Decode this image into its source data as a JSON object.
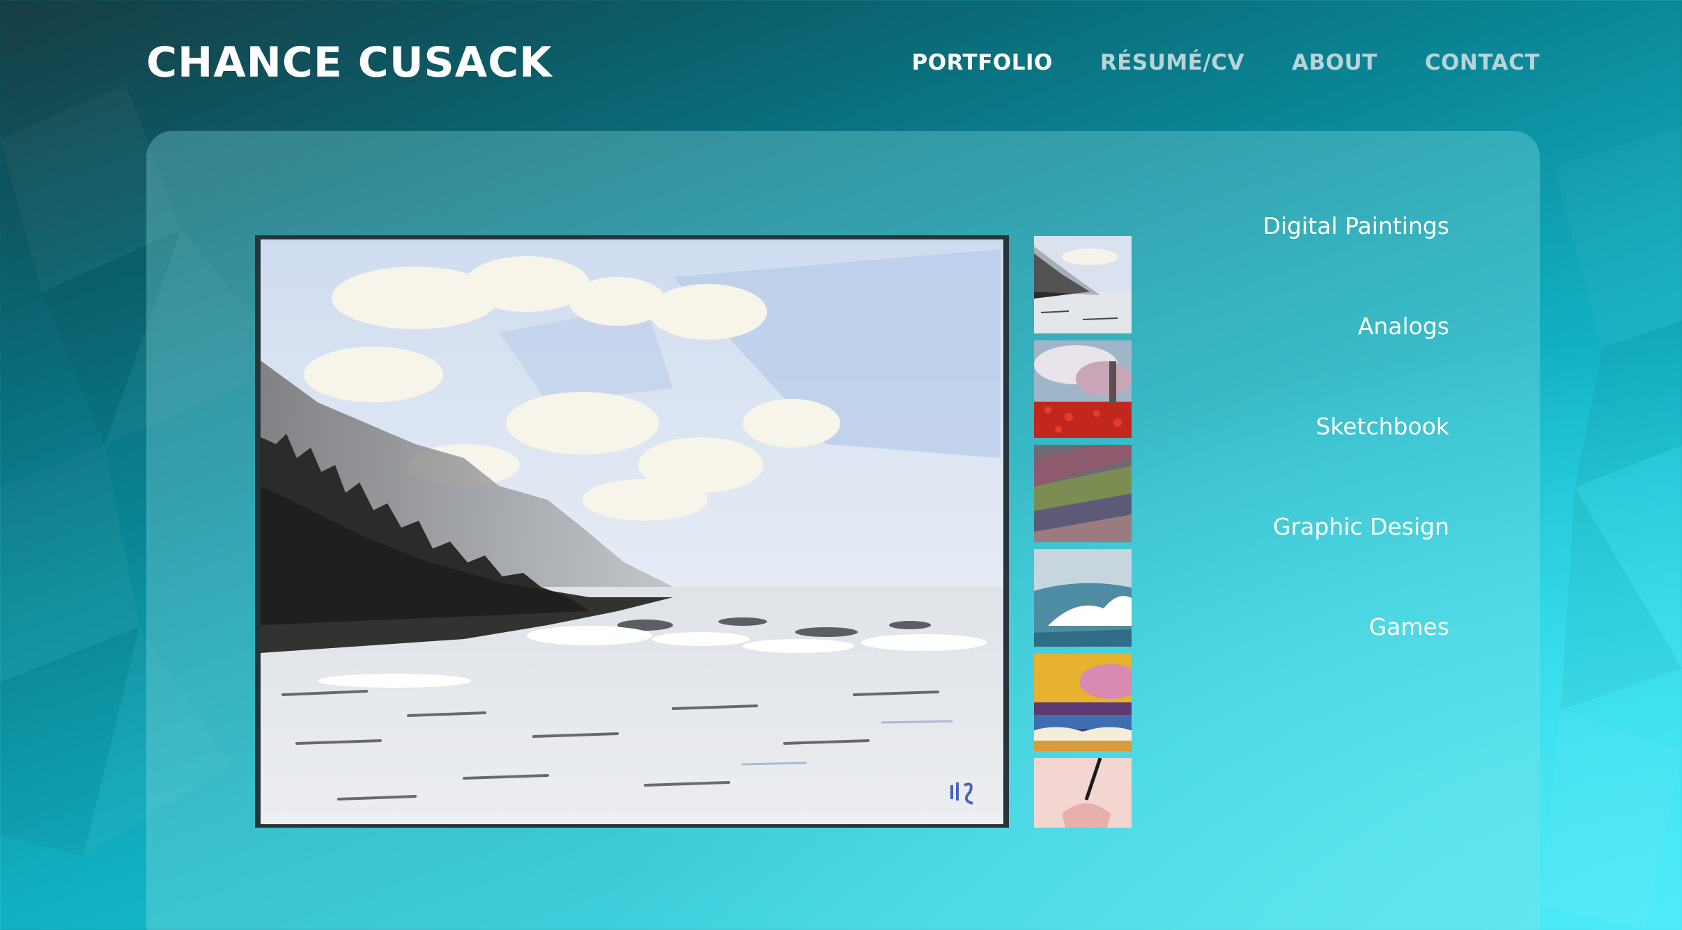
{
  "site": {
    "brand": "CHANCE CUSACK"
  },
  "nav": {
    "items": [
      {
        "label": "PORTFOLIO",
        "active": true
      },
      {
        "label": "RÉSUMÉ/CV",
        "active": false
      },
      {
        "label": "ABOUT",
        "active": false
      },
      {
        "label": "CONTACT",
        "active": false
      }
    ]
  },
  "gallery": {
    "main_image": "coastal-fog-landscape-painting",
    "thumbnails": [
      "foggy-coast-painting-thumb",
      "red-poppy-field-painting-thumb",
      "abstract-brushstroke-painting-thumb",
      "crashing-wave-painting-thumb",
      "sunset-seascape-painting-thumb",
      "figure-sketch-painting-thumb"
    ]
  },
  "categories": {
    "items": [
      {
        "label": "Digital Paintings"
      },
      {
        "label": "Analogs"
      },
      {
        "label": "Sketchbook"
      },
      {
        "label": "Graphic Design"
      },
      {
        "label": "Games"
      }
    ]
  },
  "colors": {
    "accent": "#0a8696",
    "nav_active": "#ffffff",
    "nav_inactive": "#b8d4d8"
  }
}
